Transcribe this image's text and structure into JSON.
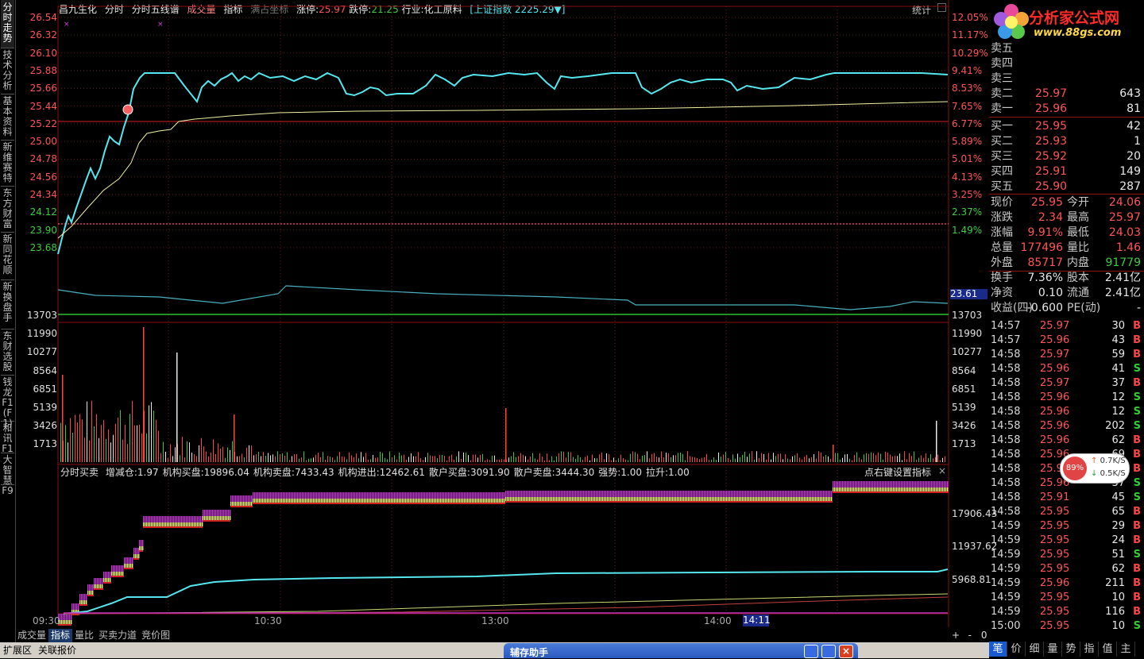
{
  "left_tabs": [
    "分时走势",
    "技术分析",
    "基本资料",
    "新维赛特",
    "东方财富",
    "新同花顺",
    "新换盘手",
    "东财选股",
    "钱龙F1 (F1)",
    "和讯F1",
    "大智慧F9"
  ],
  "header": {
    "name": "昌九生化",
    "t1": "分时",
    "t2": "分时五线谱",
    "t3": "成交量",
    "t4": "指标",
    "t5": "满占坐标",
    "zt_label": "涨停:",
    "zt": "25.97",
    "dt_label": "跌停:",
    "dt": "21.25",
    "industry": "行业:化工原料",
    "index": "[上证指数 2225.29▼]",
    "stats": "统计"
  },
  "price_axis_left": [
    "26.54",
    "26.32",
    "26.10",
    "25.88",
    "25.66",
    "25.44",
    "25.22",
    "25.00",
    "24.78",
    "24.56",
    "24.34",
    "24.12",
    "23.90",
    "23.68"
  ],
  "price_axis_right": [
    "12.05%",
    "11.17%",
    "10.29%",
    "9.41%",
    "8.53%",
    "7.65%",
    "6.77%",
    "5.89%",
    "5.01%",
    "4.13%",
    "3.25%",
    "2.37%",
    "1.49%"
  ],
  "current_tag": "23.61",
  "vol_axis": [
    "13703",
    "11990",
    "10277",
    "8564",
    "6851",
    "5139",
    "3426",
    "1713"
  ],
  "indicator_line": {
    "title": "分时买卖",
    "items": [
      "增减仓:1.97",
      "机构买盘:19896.04",
      "机构卖盘:7433.43",
      "机构进出:12462.61",
      "散户买盘:3091.90",
      "散户卖盘:3444.30",
      "强势:1.00",
      "拉升:1.00"
    ],
    "hint": "点右键设置指标"
  },
  "ind_axis": [
    "17906.43",
    "11937.62",
    "5968.81"
  ],
  "time_axis": [
    "09:30",
    "10:30",
    "13:00",
    "14:00"
  ],
  "time_tag": "14:11",
  "bottom_tabs": [
    "成交量",
    "指标",
    "量比",
    "买卖力道",
    "竞价图"
  ],
  "bottom_right": [
    "+",
    "-",
    "0"
  ],
  "status": [
    "扩展区",
    "关联报价"
  ],
  "dialog_title": "辅存助手",
  "logo": {
    "cn": "分析家公式网",
    "url": "www.88gs.com"
  },
  "order_book": [
    {
      "label": "卖五",
      "price": "",
      "vol": ""
    },
    {
      "label": "卖四",
      "price": "",
      "vol": ""
    },
    {
      "label": "卖三",
      "price": "",
      "vol": ""
    },
    {
      "label": "卖二",
      "price": "25.97",
      "vol": "643"
    },
    {
      "label": "卖一",
      "price": "25.96",
      "vol": "81"
    },
    {
      "label": "买一",
      "price": "25.95",
      "vol": "42"
    },
    {
      "label": "买二",
      "price": "25.93",
      "vol": "1"
    },
    {
      "label": "买三",
      "price": "25.92",
      "vol": "20"
    },
    {
      "label": "买四",
      "price": "25.91",
      "vol": "149"
    },
    {
      "label": "买五",
      "price": "25.90",
      "vol": "287"
    }
  ],
  "stats_rows": [
    [
      "现价",
      "25.95",
      "今开",
      "24.06"
    ],
    [
      "涨跌",
      "2.34",
      "最高",
      "25.97"
    ],
    [
      "涨幅",
      "9.91%",
      "最低",
      "24.03"
    ],
    [
      "总量",
      "177496",
      "量比",
      "1.46"
    ],
    [
      "外盘",
      "85717",
      "内盘",
      "91779"
    ],
    [
      "换手",
      "7.36%",
      "股本",
      "2.41亿"
    ],
    [
      "净资",
      "0.10",
      "流通",
      "2.41亿"
    ],
    [
      "收益(四)",
      "-0.600",
      "PE(动)",
      "-"
    ]
  ],
  "ticks": [
    [
      "14:57",
      "25.97",
      "30",
      "B"
    ],
    [
      "14:57",
      "25.96",
      "43",
      "B"
    ],
    [
      "14:58",
      "25.97",
      "59",
      "B"
    ],
    [
      "14:58",
      "25.96",
      "41",
      "S"
    ],
    [
      "14:58",
      "25.97",
      "37",
      "B"
    ],
    [
      "14:58",
      "25.96",
      "12",
      "S"
    ],
    [
      "14:58",
      "25.96",
      "12",
      "S"
    ],
    [
      "14:58",
      "25.96",
      "202",
      "S"
    ],
    [
      "14:58",
      "25.96",
      "62",
      "B"
    ],
    [
      "14:58",
      "25.96",
      "69",
      "B"
    ],
    [
      "14:58",
      "25.96",
      "",
      "B"
    ],
    [
      "14:58",
      "25.96",
      "37",
      "S"
    ],
    [
      "14:58",
      "25.91",
      "45",
      "S"
    ],
    [
      "14:58",
      "25.95",
      "65",
      "B"
    ],
    [
      "14:59",
      "25.95",
      "29",
      "B"
    ],
    [
      "14:59",
      "25.95",
      "24",
      "B"
    ],
    [
      "14:59",
      "25.95",
      "51",
      "S"
    ],
    [
      "14:59",
      "25.95",
      "62",
      "B"
    ],
    [
      "14:59",
      "25.96",
      "211",
      "B"
    ],
    [
      "14:59",
      "25.95",
      "10",
      "B"
    ],
    [
      "14:59",
      "25.95",
      "116",
      "B"
    ],
    [
      "15:00",
      "25.95",
      "10",
      "S"
    ]
  ],
  "speed": {
    "pct": "89%",
    "up": "0.7K/S",
    "down": "0.5K/S"
  },
  "quote_tabs": [
    "笔",
    "价",
    "细",
    "量",
    "势",
    "指",
    "值",
    "主"
  ],
  "colors": {
    "price_line": "#55e6ee",
    "avg_line": "#f0f0a0",
    "up": "#ff4444",
    "down": "#33cc33",
    "grid": "#8a1010"
  }
}
